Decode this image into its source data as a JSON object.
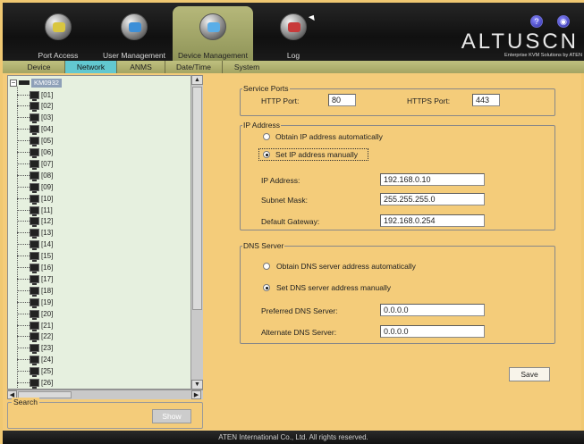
{
  "nav": {
    "items": [
      {
        "label": "Port Access",
        "icon": "port-access-icon"
      },
      {
        "label": "User Management",
        "icon": "user-management-icon"
      },
      {
        "label": "Device Management",
        "icon": "device-management-icon",
        "active": true
      },
      {
        "label": "Log",
        "icon": "log-icon"
      }
    ]
  },
  "brand": {
    "name": "ALTUSCN",
    "tagline": "Enterprise KVM Solutions by ATEN"
  },
  "subtabs": [
    "Device",
    "Network",
    "ANMS",
    "Date/Time",
    "System"
  ],
  "active_subtab": "Network",
  "tree": {
    "root": "KM0932",
    "ports": [
      "[01]",
      "[02]",
      "[03]",
      "[04]",
      "[05]",
      "[06]",
      "[07]",
      "[08]",
      "[09]",
      "[10]",
      "[11]",
      "[12]",
      "[13]",
      "[14]",
      "[15]",
      "[16]",
      "[17]",
      "[18]",
      "[19]",
      "[20]",
      "[21]",
      "[22]",
      "[23]",
      "[24]",
      "[25]",
      "[26]"
    ]
  },
  "search": {
    "label": "Search",
    "show_button": "Show"
  },
  "service_ports": {
    "legend": "Service Ports",
    "http_label": "HTTP Port:",
    "http_value": "80",
    "https_label": "HTTPS Port:",
    "https_value": "443"
  },
  "ip": {
    "legend": "IP Address",
    "auto_label": "Obtain IP address automatically",
    "manual_label": "Set IP address manually",
    "ip_label": "IP Address:",
    "ip_value": "192.168.0.10",
    "mask_label": "Subnet Mask:",
    "mask_value": "255.255.255.0",
    "gw_label": "Default Gateway:",
    "gw_value": "192.168.0.254"
  },
  "dns": {
    "legend": "DNS Server",
    "auto_label": "Obtain DNS server address automatically",
    "manual_label": "Set DNS server address manually",
    "pref_label": "Preferred DNS Server:",
    "pref_value": "0.0.0.0",
    "alt_label": "Alternate DNS Server:",
    "alt_value": "0.0.0.0"
  },
  "save_label": "Save",
  "footer": "ATEN International Co., Ltd. All rights reserved.",
  "colors": {
    "accent": "#62c8d0",
    "frame": "#f4cc7a",
    "active_nav": "#b6b87a"
  }
}
